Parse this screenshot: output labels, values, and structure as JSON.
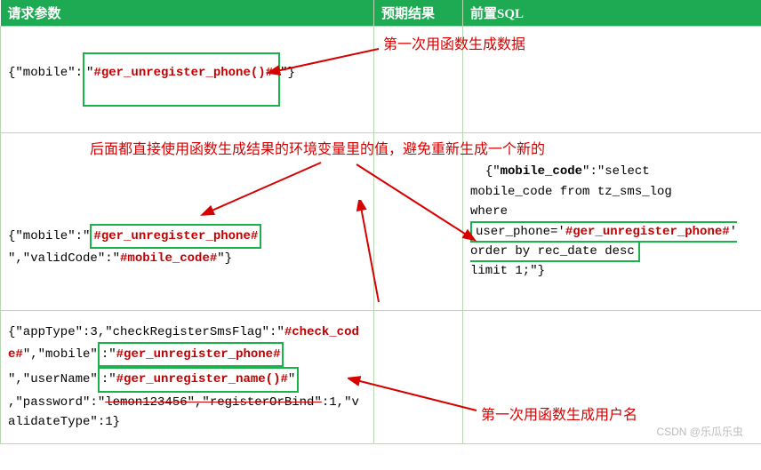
{
  "headers": {
    "col1": "请求参数",
    "col2": "预期结果",
    "col3": "前置SQL"
  },
  "row1": {
    "prefix": "{\"mobile\":",
    "quote": "\"",
    "highlight": "#ger_unregister_phone()#",
    "suffix": "\"}",
    "annot": "第一次用函数生成数据"
  },
  "row2": {
    "annot_top": "后面都直接使用函数生成结果的环境变量里的值，避免重新生成一个新的",
    "p_prefix": "{\"mobile\":\"",
    "p_hl1": "#ger_unregister_phone#",
    "p_mid": "\",\"validCode\":\"",
    "p_hl2": "#mobile_code#",
    "p_suffix": "\"}",
    "sql_l1a": "{\"",
    "sql_l1b": "mobile_code",
    "sql_l1c": "\":\"select",
    "sql_l2": "mobile_code  from tz_sms_log",
    "sql_l3": "where",
    "sql_l4a": "user_phone='",
    "sql_l4b": "#ger_unregister_phone#",
    "sql_l4c": "'  order by rec_date desc",
    "sql_l5": "limit 1;\"}"
  },
  "row3": {
    "p1": "{\"appType\":3,\"checkRegisterSmsFlag\":\"",
    "hl1": "#check_code#",
    "p2": "\",\"mobile\"",
    "p2b": ":\"",
    "hl2": "#ger_unregister_phone#",
    "p3": "\",\"userName\"",
    "p3b": ":\"",
    "hl3": "#ger_unregister_name()#",
    "p3c": "\"",
    "p4a": ",\"password\":\"",
    "p4strike": "lemon123456\",\"registerOrBind\"",
    "p4b": ":1,\"validateType\":1}",
    "annot": "第一次用函数生成用户名"
  },
  "watermark": "CSDN @乐瓜乐虫"
}
